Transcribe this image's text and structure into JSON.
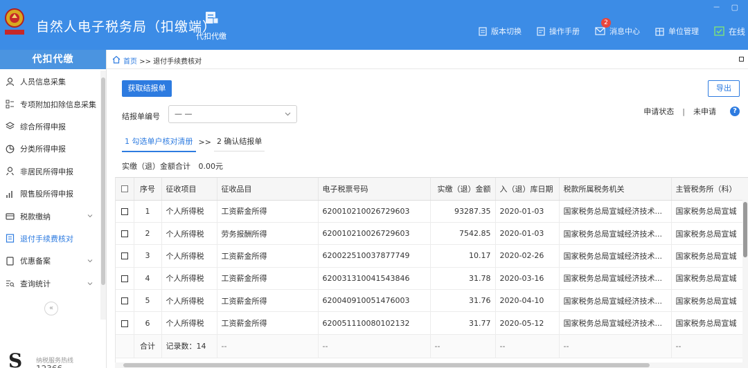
{
  "header": {
    "app_title": "自然人电子税务局（扣缴端）",
    "module_label": "代扣代缴",
    "actions": [
      {
        "label": "版本切换",
        "icon": "document-icon"
      },
      {
        "label": "操作手册",
        "icon": "manual-icon"
      },
      {
        "label": "消息中心",
        "icon": "envelope-icon",
        "badge": "2"
      },
      {
        "label": "单位管理",
        "icon": "building-icon"
      },
      {
        "label": "在线",
        "icon": "online-check-icon"
      }
    ],
    "window_controls": "－ ▢"
  },
  "sidebar": {
    "title": "代扣代缴",
    "items": [
      {
        "label": "人员信息采集",
        "icon": "person-icon"
      },
      {
        "label": "专项附加扣除信息采集",
        "icon": "list-icon"
      },
      {
        "label": "综合所得申报",
        "icon": "layers-icon"
      },
      {
        "label": "分类所得申报",
        "icon": "pie-icon"
      },
      {
        "label": "非居民所得申报",
        "icon": "person-outline-icon"
      },
      {
        "label": "限售股所得申报",
        "icon": "bar-chart-icon"
      },
      {
        "label": "税款缴纳",
        "icon": "wallet-icon",
        "expandable": true
      },
      {
        "label": "退付手续费核对",
        "icon": "receipt-icon",
        "active": true
      },
      {
        "label": "优惠备案",
        "icon": "document-icon",
        "expandable": true
      },
      {
        "label": "查询统计",
        "icon": "search-list-icon",
        "expandable": true
      }
    ],
    "collapse_label": "«",
    "hotline_label": "纳税服务热线",
    "hotline_number": "12366"
  },
  "breadcrumb": {
    "home": "首页",
    "separator": ">>",
    "current": "退付手续费核对"
  },
  "toolbar": {
    "fetch_button": "获取结报单",
    "export_button": "导出"
  },
  "form": {
    "report_no_label": "结报单编号",
    "report_no_value": "— —"
  },
  "status": {
    "label": "申请状态",
    "separator": "|",
    "value": "未申请",
    "help": "?"
  },
  "steps": {
    "step1": "1 勾选单户核对清册",
    "arrow": ">>",
    "step2": "2 确认结报单"
  },
  "summary": {
    "label": "实缴（退）金额合计",
    "amount": "0.00元"
  },
  "table": {
    "headers": [
      "序号",
      "征收项目",
      "征收品目",
      "电子税票号码",
      "实缴（退）金额",
      "入（退）库日期",
      "税款所属税务机关",
      "主管税务所（科）"
    ],
    "rows": [
      {
        "no": "1",
        "item": "个人所得税",
        "category": "工资薪金所得",
        "ticket": "620010210026729603",
        "amount": "93287.35",
        "date": "2020-01-03",
        "authority": "国家税务总局宣城经济技术...",
        "office": "国家税务总局宣城"
      },
      {
        "no": "2",
        "item": "个人所得税",
        "category": "劳务报酬所得",
        "ticket": "620010210026729603",
        "amount": "7542.85",
        "date": "2020-01-03",
        "authority": "国家税务总局宣城经济技术...",
        "office": "国家税务总局宣城"
      },
      {
        "no": "3",
        "item": "个人所得税",
        "category": "工资薪金所得",
        "ticket": "620022510037877749",
        "amount": "10.17",
        "date": "2020-02-26",
        "authority": "国家税务总局宣城经济技术...",
        "office": "国家税务总局宣城"
      },
      {
        "no": "4",
        "item": "个人所得税",
        "category": "工资薪金所得",
        "ticket": "620031310041543846",
        "amount": "31.78",
        "date": "2020-03-16",
        "authority": "国家税务总局宣城经济技术...",
        "office": "国家税务总局宣城"
      },
      {
        "no": "5",
        "item": "个人所得税",
        "category": "工资薪金所得",
        "ticket": "620040910051476003",
        "amount": "31.76",
        "date": "2020-04-10",
        "authority": "国家税务总局宣城经济技术...",
        "office": "国家税务总局宣城"
      },
      {
        "no": "6",
        "item": "个人所得税",
        "category": "工资薪金所得",
        "ticket": "620051110080102132",
        "amount": "31.77",
        "date": "2020-05-12",
        "authority": "国家税务总局宣城经济技术...",
        "office": "国家税务总局宣城"
      }
    ],
    "total": {
      "label": "合计",
      "count": "记录数：14",
      "placeholder": "--"
    }
  },
  "colors": {
    "header_bg": "#3c8ce6",
    "accent": "#2d7be0",
    "badge": "#e8463c"
  }
}
